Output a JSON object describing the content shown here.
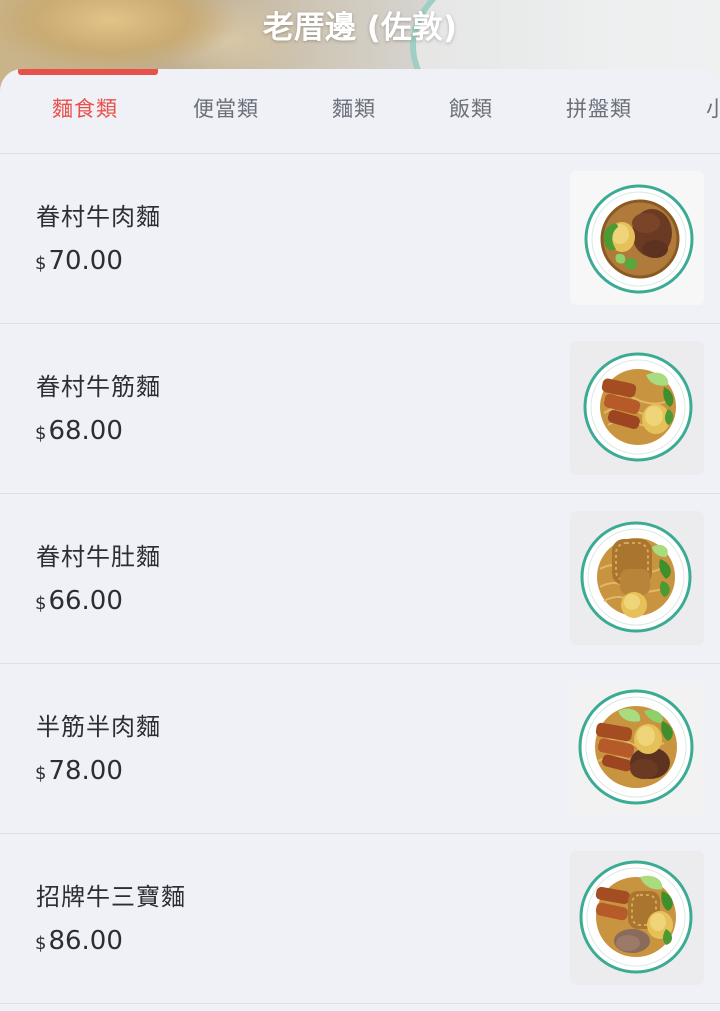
{
  "header": {
    "store_name": "老厝邊 (佐敦)"
  },
  "tabs": [
    {
      "label": "麵食類",
      "active": true
    },
    {
      "label": "便當類",
      "active": false
    },
    {
      "label": "麵類",
      "active": false
    },
    {
      "label": "飯類",
      "active": false
    },
    {
      "label": "拼盤類",
      "active": false
    },
    {
      "label": "小",
      "active": false
    }
  ],
  "menu": {
    "currency_symbol": "$",
    "items": [
      {
        "name": "眷村牛肉麵",
        "price": "70.00",
        "dish": "beef-noodle-bowl-image"
      },
      {
        "name": "眷村牛筋麵",
        "price": "68.00",
        "dish": "beef-tendon-noodle-bowl-image"
      },
      {
        "name": "眷村牛肚麵",
        "price": "66.00",
        "dish": "beef-tripe-noodle-bowl-image"
      },
      {
        "name": "半筋半肉麵",
        "price": "78.00",
        "dish": "half-tendon-half-beef-noodle-bowl-image"
      },
      {
        "name": "招牌牛三寶麵",
        "price": "86.00",
        "dish": "signature-beef-trio-noodle-bowl-image"
      }
    ]
  },
  "colors": {
    "accent": "#e8504a",
    "background": "#eff1f7",
    "plate_rim": "#3cab93"
  }
}
